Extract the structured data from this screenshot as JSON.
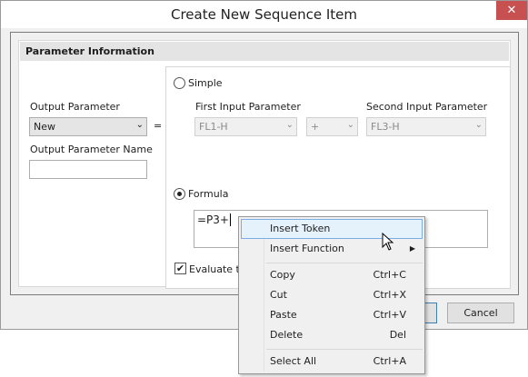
{
  "window": {
    "title": "Create New Sequence Item",
    "close_label": "✕"
  },
  "group": {
    "title": "Parameter Information"
  },
  "output": {
    "param_label": "Output Parameter",
    "param_value": "New",
    "equals": "=",
    "name_label": "Output Parameter Name",
    "name_value": ""
  },
  "simple": {
    "label": "Simple",
    "first_label": "First Input Parameter",
    "first_value": "FL1-H",
    "operator_value": "+",
    "second_label": "Second Input Parameter",
    "second_value": "FL3-H"
  },
  "formula": {
    "label": "Formula",
    "value": "=P3+"
  },
  "evaluate": {
    "label": "Evaluate to"
  },
  "buttons": {
    "ok_label": "",
    "cancel_label": "Cancel"
  },
  "context_menu": {
    "items": [
      {
        "label": "Insert Token",
        "shortcut": ""
      },
      {
        "label": "Insert Function",
        "shortcut": ""
      },
      {
        "label": "Copy",
        "shortcut": "Ctrl+C"
      },
      {
        "label": "Cut",
        "shortcut": "Ctrl+X"
      },
      {
        "label": "Paste",
        "shortcut": "Ctrl+V"
      },
      {
        "label": "Delete",
        "shortcut": "Del"
      },
      {
        "label": "Select All",
        "shortcut": "Ctrl+A"
      }
    ]
  },
  "colors": {
    "close": "#c75050",
    "highlight": "#e5f1fb",
    "highlight_border": "#78aee5"
  },
  "icons": {
    "close": "close-icon",
    "chevron": "chevron-down-icon",
    "submenu": "submenu-arrow-icon",
    "cursor": "mouse-pointer-icon"
  }
}
